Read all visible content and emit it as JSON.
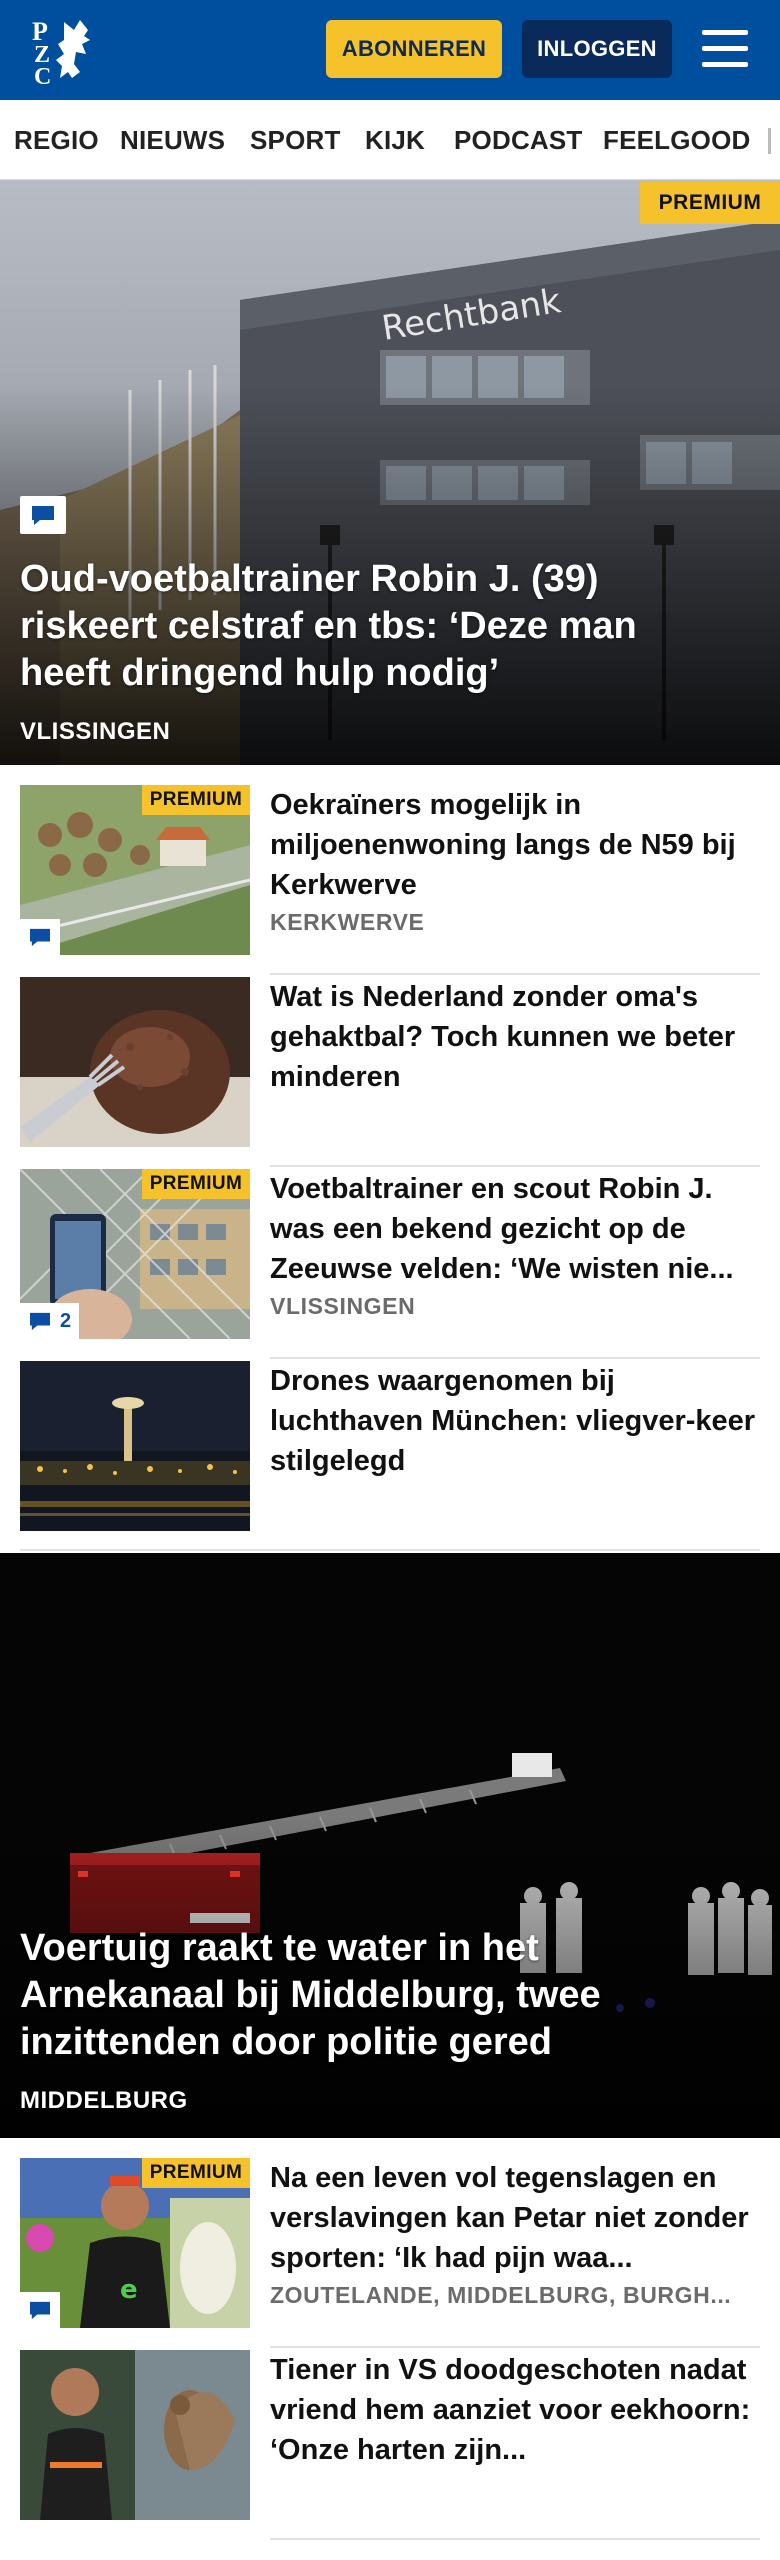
{
  "header": {
    "logo_text": "PZC",
    "subscribe_label": "ABONNEREN",
    "login_label": "INLOGGEN",
    "menu_icon": "hamburger-menu-icon",
    "brand_color": "#004f9f",
    "accent_color": "#f5c22b"
  },
  "nav": {
    "items": [
      "REGIO",
      "NIEUWS",
      "SPORT",
      "KIJK",
      "PODCAST",
      "FEELGOOD"
    ]
  },
  "hero1": {
    "premium_label": "PREMIUM",
    "building_sign": "Rechtbank",
    "title": "Oud-voetbaltrainer Robin J. (39) riskeert celstraf en tbs: ‘Deze man heeft dringend hulp nodig’",
    "location": "VLISSINGEN",
    "comment_icon": "comment-icon"
  },
  "articles_a": [
    {
      "title": "Oekraïners mogelijk in miljoenenwoning langs de N59 bij Kerkwerve",
      "location": "KERKWERVE",
      "premium": "PREMIUM",
      "comments": ""
    },
    {
      "title": "Wat is Nederland zonder oma's gehaktbal? Toch kunnen we beter minderen",
      "location": "",
      "premium": "",
      "comments": ""
    },
    {
      "title": "Voetbaltrainer en scout Robin J. was een bekend gezicht op de Zeeuwse velden: ‘We wisten nie...",
      "location": "VLISSINGEN",
      "premium": "PREMIUM",
      "comments": "2"
    },
    {
      "title": "Drones waargenomen bij luchthaven München: vliegver-keer stilgelegd",
      "location": "",
      "premium": "",
      "comments": ""
    }
  ],
  "hero2": {
    "title": "Voertuig raakt te water in het Arnekanaal bij Middelburg, twee inzittenden door politie gered",
    "location": "MIDDELBURG"
  },
  "articles_b": [
    {
      "title": "Na een leven vol tegenslagen en verslavingen kan Petar niet zonder sporten: ‘Ik had pijn waa...",
      "location": "ZOUTELANDE, MIDDELBURG, BURGH...",
      "premium": "PREMIUM",
      "comments": ""
    },
    {
      "title": "Tiener in VS doodgeschoten nadat vriend hem aanziet voor eekhoorn: ‘Onze harten zijn...",
      "location": "",
      "premium": "",
      "comments": ""
    }
  ]
}
